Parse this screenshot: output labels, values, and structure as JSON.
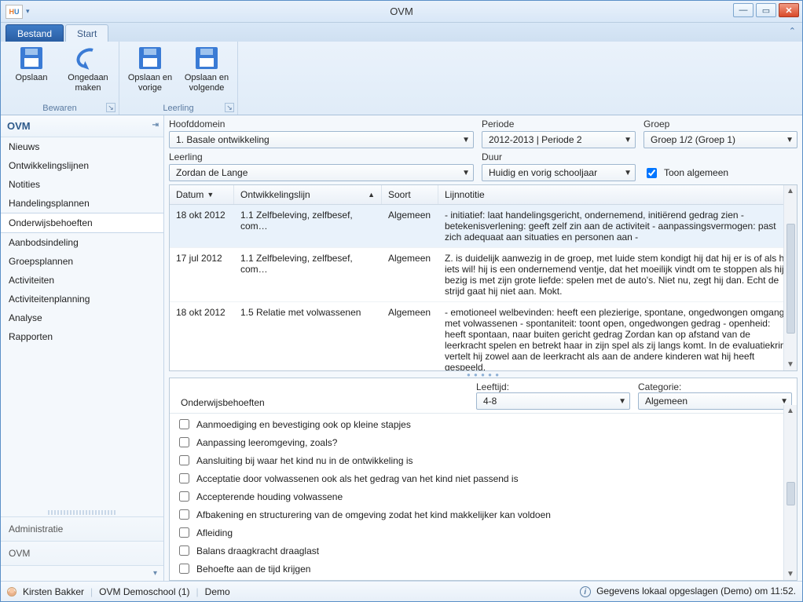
{
  "window": {
    "title": "OVM"
  },
  "tabs": {
    "file": "Bestand",
    "start": "Start"
  },
  "ribbon": {
    "bewaren": {
      "caption": "Bewaren",
      "opslaan": "Opslaan",
      "ongedaan": "Ongedaan maken"
    },
    "leerling": {
      "caption": "Leerling",
      "prev": "Opslaan en vorige",
      "next": "Opslaan en volgende"
    }
  },
  "sidebar": {
    "header": "OVM",
    "items": [
      "Nieuws",
      "Ontwikkelingslijnen",
      "Notities",
      "Handelingsplannen",
      "Onderwijsbehoeften",
      "Aanbodsindeling",
      "Groepsplannen",
      "Activiteiten",
      "Activiteitenplanning",
      "Analyse",
      "Rapporten"
    ],
    "selected_index": 4,
    "admin": "Administratie",
    "ovm": "OVM"
  },
  "filters": {
    "hoofddomein_label": "Hoofddomein",
    "hoofddomein_value": "1. Basale ontwikkeling",
    "periode_label": "Periode",
    "periode_value": "2012-2013 | Periode 2",
    "groep_label": "Groep",
    "groep_value": "Groep 1/2 (Groep 1)",
    "leerling_label": "Leerling",
    "leerling_value": "Zordan de Lange",
    "duur_label": "Duur",
    "duur_value": "Huidig en vorig schooljaar",
    "toon_algemeen": "Toon algemeen"
  },
  "grid": {
    "cols": {
      "datum": "Datum",
      "ontw": "Ontwikkelingslijn",
      "soort": "Soort",
      "lijn": "Lijnnotitie"
    },
    "rows": [
      {
        "datum": "18 okt 2012",
        "ontw": "1.1 Zelfbeleving, zelfbesef, com…",
        "soort": "Algemeen",
        "lijn": " - initiatief: laat handelingsgericht, ondernemend, initiërend gedrag zien - betekenisverlening: geeft zelf zin aan de activiteit - aanpassingsvermogen: past zich adequaat aan situaties en personen aan -"
      },
      {
        "datum": "17 jul 2012",
        "ontw": "1.1 Zelfbeleving, zelfbesef, com…",
        "soort": "Algemeen",
        "lijn": "Z. is duidelijk aanwezig in de groep, met luide stem kondigt hij dat hij er is of als hij iets wil! hij is een ondernemend ventje, dat het moeilijk vindt om te stoppen als hij bezig is met zijn grote liefde: spelen met de auto's. Niet nu, zegt hij dan. Echt de strijd gaat hij niet aan. Mokt."
      },
      {
        "datum": "18 okt 2012",
        "ontw": "1.5 Relatie met volwassenen",
        "soort": "Algemeen",
        "lijn": " - emotioneel welbevinden: heeft een plezierige, spontane, ongedwongen omgang met volwassenen - spontaniteit: toont open, ongedwongen gedrag - openheid: heeft spontaan, naar buiten gericht gedrag Zordan kan op afstand van de leerkracht spelen en betrekt haar in zijn spel als zij langs komt. In de evaluatiekring vertelt hij zowel aan de leerkracht als aan de andere kinderen wat hij heeft gespeeld."
      }
    ]
  },
  "lower": {
    "leeftijd_label": "Leeftijd:",
    "leeftijd_value": "4-8",
    "categorie_label": "Categorie:",
    "categorie_value": "Algemeen",
    "title": "Onderwijsbehoeften",
    "needs": [
      "Aanmoediging en bevestiging ook op kleine stapjes",
      "Aanpassing leeromgeving, zoals?",
      "Aansluiting bij waar het kind nu in de ontwikkeling is",
      "Acceptatie door volwassenen ook als het gedrag van het kind niet passend is",
      "Accepterende houding volwassene",
      "Afbakening en structurering van de omgeving zodat het kind makkelijker kan voldoen",
      "Afleiding",
      "Balans draagkracht draaglast",
      "Behoefte aan de tijd krijgen"
    ]
  },
  "status": {
    "user": "Kirsten Bakker",
    "school": "OVM Demoschool (1)",
    "mode": "Demo",
    "right": "Gegevens lokaal opgeslagen (Demo) om 11:52."
  }
}
